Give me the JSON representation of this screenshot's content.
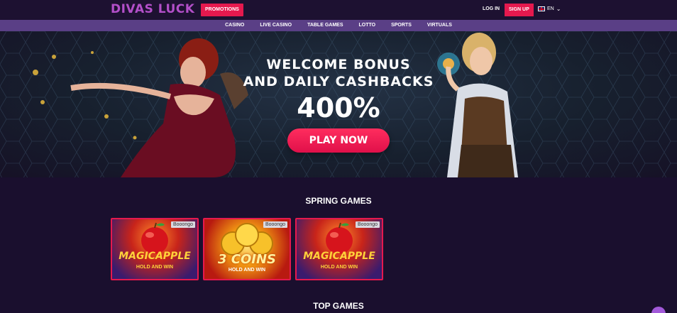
{
  "header": {
    "logo": "DIVAS LUCK",
    "promotions": "PROMOTIONS",
    "login": "LOG IN",
    "signup": "SIGN UP",
    "language": "EN"
  },
  "nav": {
    "items": [
      {
        "label": "CASINO"
      },
      {
        "label": "LIVE CASINO"
      },
      {
        "label": "TABLE GAMES"
      },
      {
        "label": "LOTTO"
      },
      {
        "label": "SPORTS"
      },
      {
        "label": "VIRTUALS"
      }
    ]
  },
  "hero": {
    "line1": "WELCOME BONUS",
    "line2": "AND DAILY CASHBACKS",
    "percent": "400%",
    "cta": "PLAY NOW"
  },
  "sections": {
    "spring": "SPRING GAMES",
    "top": "TOP GAMES"
  },
  "games": [
    {
      "provider": "Booongo",
      "title": "MAGICAPPLE",
      "subtitle": "HOLD AND WIN"
    },
    {
      "provider": "Booongo",
      "title": "3 COINS",
      "subtitle": "HOLD AND WIN"
    },
    {
      "provider": "Booongo",
      "title": "MAGICAPPLE",
      "subtitle": "HOLD AND WIN"
    }
  ],
  "colors": {
    "accent": "#e5194e",
    "nav": "#5a3f86",
    "background": "#1a0f2e",
    "logo": "#b34fc9"
  }
}
